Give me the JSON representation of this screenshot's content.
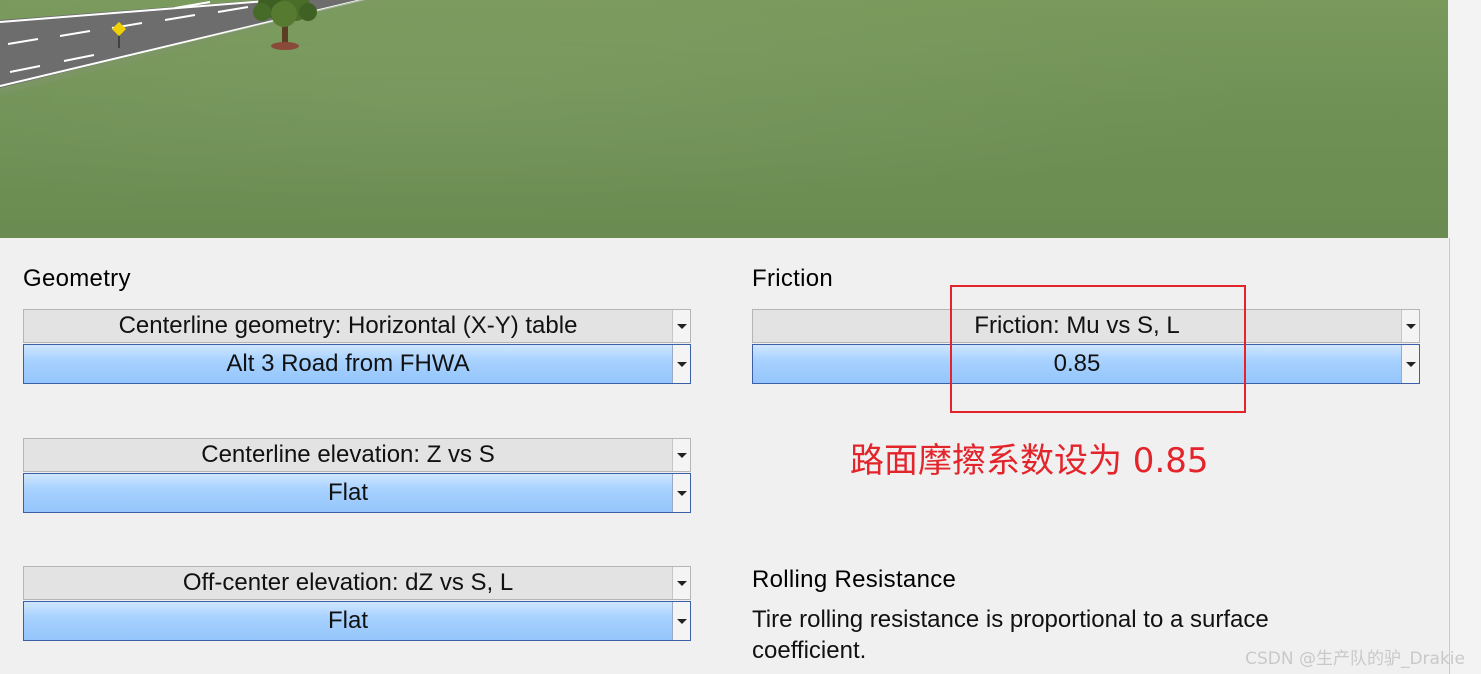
{
  "geometry": {
    "title": "Geometry",
    "centerline_geometry": {
      "header": "Centerline geometry: Horizontal (X-Y) table",
      "value": "Alt 3 Road from FHWA"
    },
    "centerline_elevation": {
      "header": "Centerline elevation: Z vs S",
      "value": "Flat"
    },
    "offcenter_elevation": {
      "header": "Off-center elevation: dZ vs S, L",
      "value": "Flat"
    }
  },
  "friction": {
    "title": "Friction",
    "header": "Friction: Mu vs S, L",
    "value": "0.85"
  },
  "rolling_resistance": {
    "title": "Rolling Resistance",
    "description": "Tire rolling resistance is proportional to a surface coefficient."
  },
  "annotation": {
    "text": "路面摩擦系数设为 0.85",
    "color": "#e3242b"
  },
  "watermark": "CSDN @生产队的驴_Drakie",
  "colors": {
    "value_blue": "#a8d2ff",
    "grass": "#6f9155",
    "road": "#6e6e6e"
  }
}
